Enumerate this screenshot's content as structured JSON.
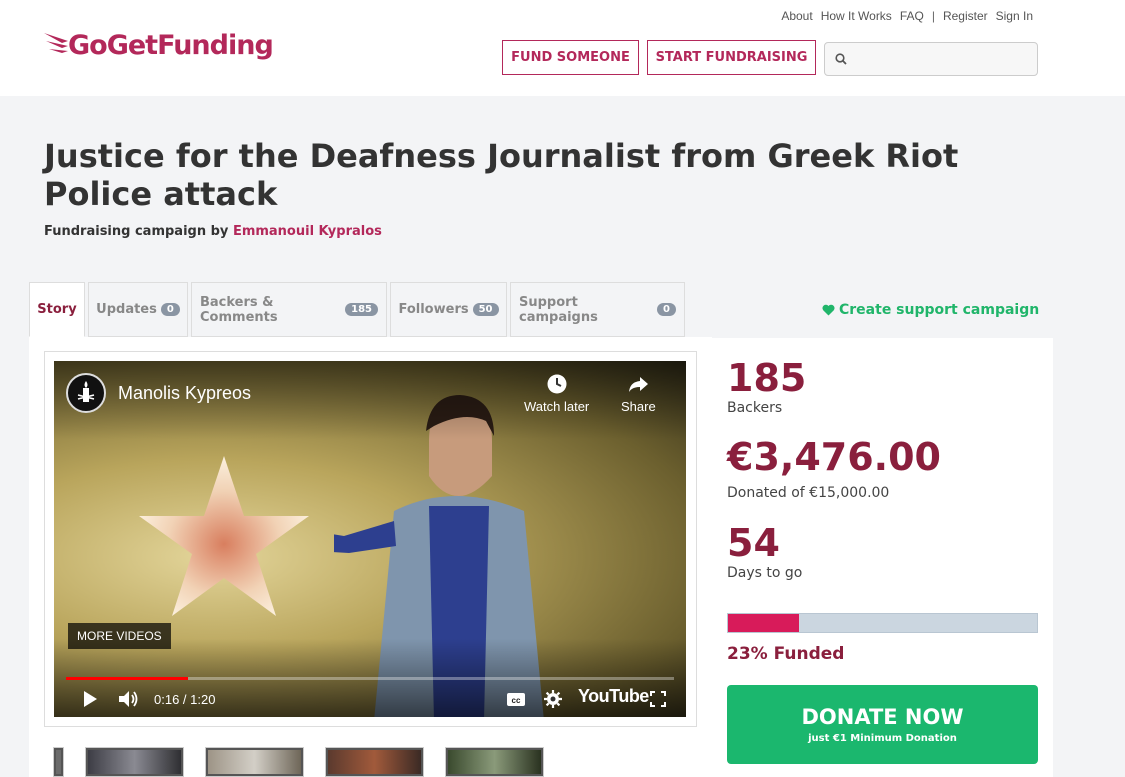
{
  "header": {
    "top_links": [
      "About",
      "How It Works",
      "FAQ",
      "|",
      "Register",
      "Sign In"
    ],
    "logo_text": "GoGetFunding",
    "fund_someone": "FUND SOMEONE",
    "start_fundraising": "START FUNDRAISING",
    "search": {
      "value": "",
      "placeholder": ""
    }
  },
  "campaign": {
    "title": "Justice for the Deafness Journalist from Greek Riot Police attack",
    "byline_prefix": "Fundraising campaign by",
    "author": "Emmanouil Kypralos"
  },
  "tabs": [
    {
      "label": "Story",
      "count": null
    },
    {
      "label": "Updates",
      "count": "0"
    },
    {
      "label": "Backers & Comments",
      "count": "185"
    },
    {
      "label": "Followers",
      "count": "50"
    },
    {
      "label": "Support campaigns",
      "count": "0"
    }
  ],
  "support_link": "Create support campaign",
  "video": {
    "channel": "Manolis Kypreos",
    "watch_later": "Watch later",
    "share": "Share",
    "more_videos": "MORE VIDEOS",
    "time": "0:16 / 1:20",
    "progress": 0.2,
    "brand": "YouTube"
  },
  "stats": {
    "backers_count": "185",
    "backers_label": "Backers",
    "donated": "€3,476.00",
    "donated_label": "Donated of €15,000.00",
    "days": "54",
    "days_label": "Days to go",
    "funded_fraction": 0.23,
    "funded_label": "23% Funded"
  },
  "donate": {
    "label": "DONATE NOW",
    "sub": "just €1 Minimum Donation"
  },
  "colors": {
    "brand": "#b3285a",
    "stat": "#8a1f3d",
    "donate": "#1bb76e",
    "bar_fill": "#d81b5a"
  }
}
